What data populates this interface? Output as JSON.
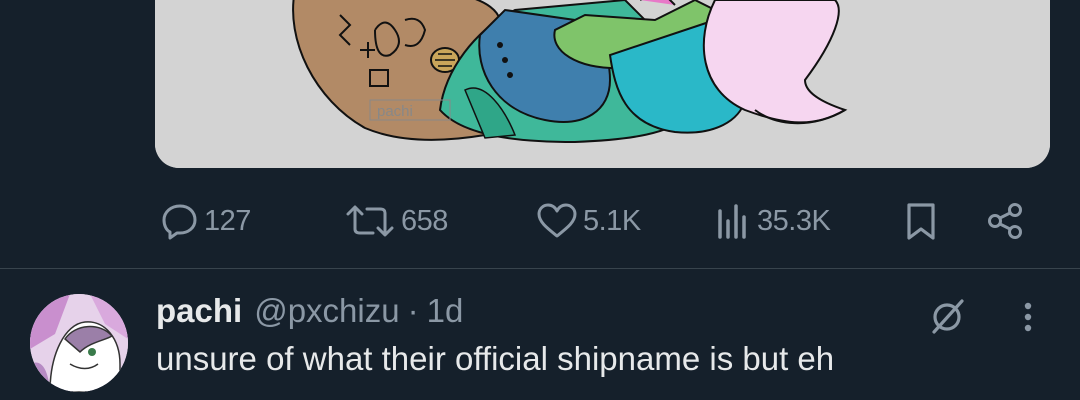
{
  "media": {
    "signature": "pachi"
  },
  "actions": {
    "replies": "127",
    "reposts": "658",
    "likes": "5.1K",
    "views": "35.3K"
  },
  "next_tweet": {
    "display_name": "pachi",
    "handle": "@pxchizu",
    "separator": "·",
    "time": "1d",
    "text": "unsure of what their official shipname is but eh"
  },
  "icons": {
    "reply": "reply-bubble-icon",
    "repost": "repost-arrows-icon",
    "like": "heart-icon",
    "views": "bar-chart-icon",
    "bookmark": "bookmark-icon",
    "share": "share-icon",
    "grok": "grok-slash-icon",
    "more": "vertical-dots-icon"
  },
  "colors": {
    "background": "#15202b",
    "text_primary": "#e7e9ea",
    "text_secondary": "#8b98a5",
    "divider": "#38444d",
    "media_bg": "#d3d3d3"
  }
}
